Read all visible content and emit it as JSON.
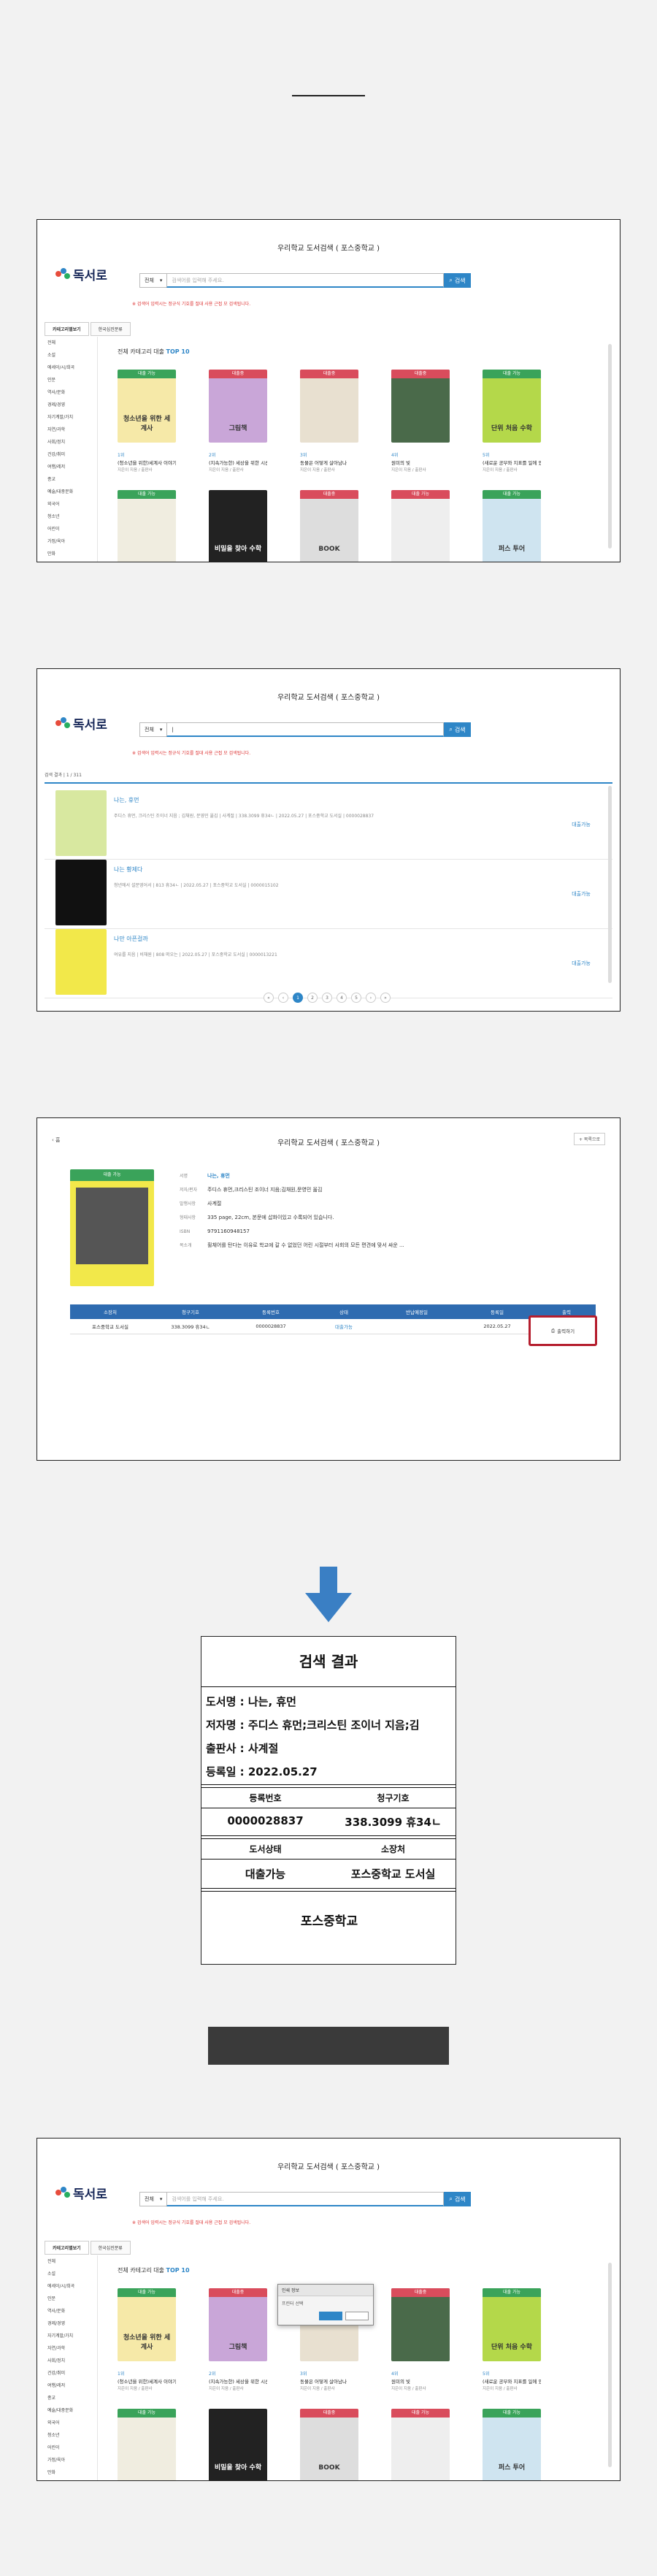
{
  "frame_title": "우리학교 도서검색 ( 포스중학교 )",
  "logo_text": "독서로",
  "search": {
    "scope": "전체",
    "placeholder": "검색어를 입력해 주세요.",
    "button": "검색"
  },
  "notice": "※ 검색어 입력시는 정규식 기호를 절대 사용 근접 모 검색됩니다.",
  "tabs": [
    "카테고리별보기",
    "한국십진분류"
  ],
  "sidebar": [
    "전체",
    "소설",
    "에세이/시/희곡",
    "인문",
    "역사/문화",
    "경제/경영",
    "자기계발/가치",
    "자연/과학",
    "사회/정치",
    "건강/취미",
    "여행/레저",
    "종교",
    "예술/대중문화",
    "외국어",
    "청소년",
    "어린이",
    "가정/육아",
    "만화",
    "사전/참고서/학습"
  ],
  "top10": {
    "prefix": "전체 카테고리 대출",
    "highlight": "TOP 10"
  },
  "books_row1": [
    {
      "band": "대출 가능",
      "title": "청소년을 위한 세계사",
      "rank": "1위",
      "name": "(청소년을 위한)세계사 이야기",
      "sub": "지은이 지음 / 출판사"
    },
    {
      "band": "대출중",
      "title": "그림책",
      "rank": "2위",
      "name": "(지속가능한) 세상을 위한 시선",
      "sub": "지은이 지음 / 출판사"
    },
    {
      "band": "대출중",
      "title": "",
      "rank": "3위",
      "name": "동물은 어떻게 살아남나",
      "sub": "지은이 지음 / 출판사"
    },
    {
      "band": "대출중",
      "title": "",
      "rank": "4위",
      "name": "원미의 빛",
      "sub": "지은이 지음 / 출판사"
    },
    {
      "band": "대출 가능",
      "title": "단위 처음 수학",
      "rank": "5위",
      "name": "(새로운 공부와 지표를 일에 있",
      "sub": "지은이 지음 / 출판사"
    }
  ],
  "books_row2": [
    {
      "band": "대출 가능",
      "title": ""
    },
    {
      "band": "",
      "title": "비밀을 찾아 수학"
    },
    {
      "band": "대출중",
      "title": "BOOK"
    },
    {
      "band": "대출 가능",
      "title": ""
    },
    {
      "band": "대출 가능",
      "title": "퍼스 투어"
    }
  ],
  "results": {
    "summary": "검색 결과 | 1 / 311",
    "rows": [
      {
        "title": "나는, 휴먼",
        "meta": "주디스 휴먼, 크리스틴 조이너 지음 ; 김채원, 문영민 옮김 | 사계절 | 338.3099 휴34ㄴ | 2022.05.27 | 포스중학교 도서실 | 0000028837",
        "status": "대출가능"
      },
      {
        "title": "나는 황제다",
        "meta": "청년에서 설문영어서 | 813 휴34ㄴ | 2022.05.27 | 포스중학교 도서실 | 0000015102",
        "status": "대출가능"
      },
      {
        "title": "나만 아픈걸까",
        "meta": "여유를 지음 | 비채원 | 808 떠오는 | 2022.05.27 | 포스중학교 도서실 | 0000013221",
        "status": "대출가능"
      }
    ],
    "pages": [
      "«",
      "‹",
      "1",
      "2",
      "3",
      "4",
      "5",
      "›",
      "»"
    ]
  },
  "detail": {
    "back": "‹ 홈",
    "print_top": "+ 목록으로",
    "fields": [
      {
        "k": "서명",
        "v": "나는, 휴먼"
      },
      {
        "k": "저자/편자",
        "v": "주디스 휴먼,크리스틴 조이너 지음;김채원,문영민 옮김"
      },
      {
        "k": "발행사항",
        "v": "사계절"
      },
      {
        "k": "형태사항",
        "v": "335 page, 22cm, 본문에 삽화이있고 수록되어 있습니다."
      },
      {
        "k": "ISBN",
        "v": "9791160948157"
      },
      {
        "k": "목소개",
        "v": "휠체어를 탄다는 이유로 학교에 갈 수 없었던 어린 시절부터 사회의 모든 편견에 맞서 싸운 ..."
      }
    ],
    "table_head": [
      "소장처",
      "청구기호",
      "등록번호",
      "상태",
      "반납예정일",
      "등록일",
      "출력"
    ],
    "table_row": [
      "포스중학교 도서실",
      "338.3099 휴34ㄴ",
      "0000028837",
      "대출가능",
      "",
      "2022.05.27",
      "출력하기"
    ]
  },
  "receipt": {
    "title": "검색 결과",
    "book_name": "도서명 : 나는, 휴먼",
    "author": "저자명 : 주디스 휴먼;크리스틴 조이너 지음;김",
    "publisher": "출판사 : 사계절",
    "reg_date": "등록일 : 2022.05.27",
    "h1": "등록번호",
    "h2": "청구기호",
    "v1": "0000028837",
    "v2": "338.3099 휴34ㄴ",
    "h3": "도서상태",
    "h4": "소장처",
    "v3": "대출가능",
    "v4": "포스중학교 도서실",
    "school": "포스중학교"
  },
  "dialog": {
    "title": "인쇄 정보",
    "body": "프린터 선택"
  },
  "colors": {
    "accent": "#2e86c7",
    "print_border": "#b51e2e",
    "arrow": "#3a7fc4"
  }
}
